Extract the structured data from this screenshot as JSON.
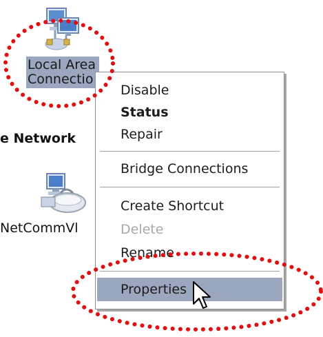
{
  "desktop": {
    "lan_label_line1": "Local Area",
    "lan_label_line2": "Connectio",
    "network_heading": "e Network",
    "netcomm_label": "NetCommVl"
  },
  "menu": {
    "items": [
      {
        "label": "Disable",
        "style": "normal"
      },
      {
        "label": "Status",
        "style": "bold"
      },
      {
        "label": "Repair",
        "style": "normal"
      },
      {
        "label": "Bridge Connections",
        "style": "normal"
      },
      {
        "label": "Create Shortcut",
        "style": "normal"
      },
      {
        "label": "Delete",
        "style": "disabled"
      },
      {
        "label": "Rename",
        "style": "normal"
      },
      {
        "label": "Properties",
        "style": "highlighted"
      }
    ]
  },
  "annotation": {
    "color": "#e01010"
  },
  "colors": {
    "selection": "#9aa7be"
  }
}
